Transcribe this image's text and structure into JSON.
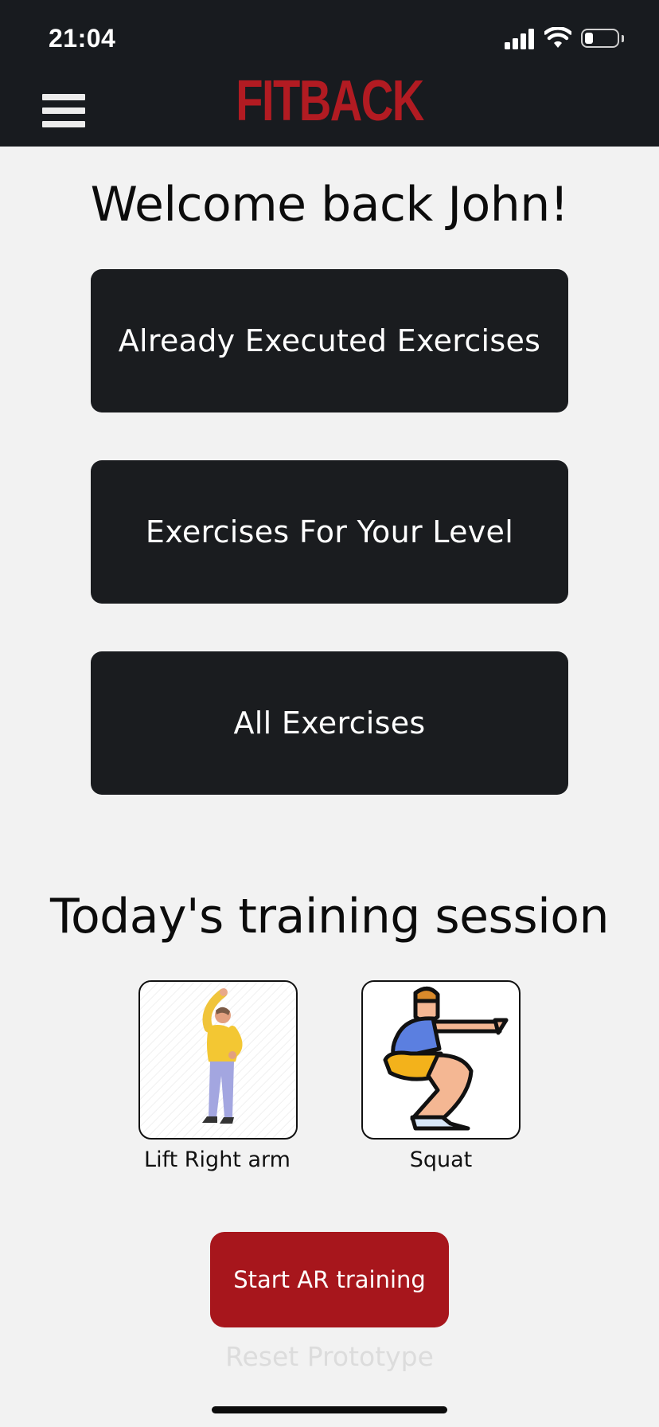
{
  "status_bar": {
    "time": "21:04"
  },
  "header": {
    "logo_text": "FITBACK",
    "logo_color": "#b21b22",
    "menu_icon": "hamburger-menu-icon"
  },
  "welcome": {
    "title": "Welcome back John!"
  },
  "menu": {
    "buttons": [
      {
        "label": "Already Executed Exercises"
      },
      {
        "label": "Exercises For Your Level"
      },
      {
        "label": "All Exercises"
      }
    ]
  },
  "session": {
    "title": "Today's training session",
    "exercises": [
      {
        "label": "Lift Right arm",
        "icon": "person-lifting-arm-illustration"
      },
      {
        "label": "Squat",
        "icon": "squat-pose-illustration"
      }
    ]
  },
  "actions": {
    "start_label": "Start AR training",
    "start_color": "#a7161c",
    "reset_label": "Reset Prototype"
  }
}
